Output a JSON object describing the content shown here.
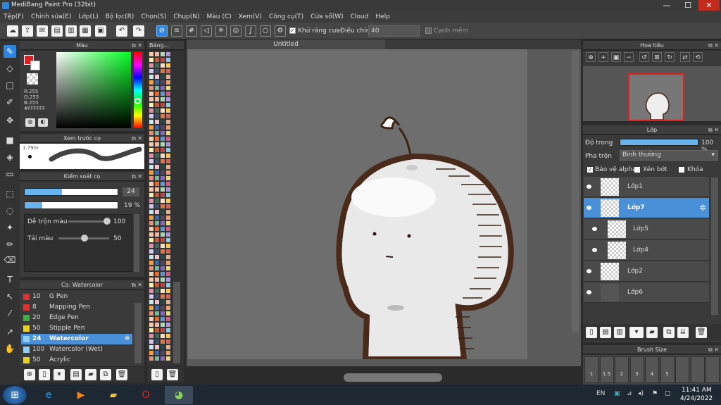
{
  "window": {
    "title": "MediBang Paint Pro (32bit)",
    "min": "—",
    "max": "☐",
    "close": "✕"
  },
  "menu": [
    "Tệp(F)",
    "Chỉnh sửa(E)",
    "Lớp(L)",
    "Bộ lọc(R)",
    "Chọn(S)",
    "Chụp(N)",
    "Màu (C)",
    "Xem(V)",
    "Công cụ(T)",
    "Cửa sổ(W)",
    "Cloud",
    "Help"
  ],
  "toolbar": {
    "antialias_label": "Khử răng cưa",
    "adjust_label": "Điều chỉnh",
    "adjust_value": "40",
    "snap_label": "Cạnh mềm"
  },
  "color_panel": {
    "title": "Màu",
    "r": "R:255",
    "g": "G:255",
    "b": "B:255",
    "hex": "#FFFFFF"
  },
  "preview_panel": {
    "title": "Xem trước cọ",
    "size": "1.79m"
  },
  "brush_control": {
    "title": "Kiểm soát cọ",
    "size": "24",
    "opacity": "19 %",
    "opacity_fraction": 0.19,
    "size_fraction": 0.4,
    "mix_label": "Dễ trộn màu",
    "mix_value": "100",
    "load_label": "Tải màu",
    "load_value": "50"
  },
  "brush_list": {
    "title": "Cọ: Watercolor",
    "items": [
      {
        "size": "10",
        "name": "G Pen",
        "color": "#e03030"
      },
      {
        "size": "8",
        "name": "Mapping Pen",
        "color": "#e03030"
      },
      {
        "size": "20",
        "name": "Edge Pen",
        "color": "#3cb043"
      },
      {
        "size": "50",
        "name": "Stipple Pen",
        "color": "#e8d020"
      },
      {
        "size": "24",
        "name": "Watercolor",
        "color": "#8fd0f0"
      },
      {
        "size": "100",
        "name": "Watercolor (Wet)",
        "color": "#8fd0f0"
      },
      {
        "size": "50",
        "name": "Acrylic",
        "color": "#e8d020"
      }
    ]
  },
  "palette_panel": {
    "title": "Bảng..."
  },
  "canvas": {
    "title": "Untitled"
  },
  "navigator": {
    "title": "Hoa tiêu"
  },
  "layer_panel": {
    "title": "Lớp",
    "opacity_label": "Độ trong",
    "opacity_value": "100 %",
    "blend_label": "Pha trộn",
    "blend_value": "Bình thường",
    "protect_alpha": "Bảo vệ alpha",
    "clipping": "Xén bớt",
    "lock": "Khóa",
    "layers": [
      "Lớp1",
      "Lớp7",
      "Lớp5",
      "Lớp4",
      "Lớp2",
      "Lớp6"
    ]
  },
  "brush_size_panel": {
    "title": "Brush Size",
    "sizes": [
      "1",
      "1.5",
      "2",
      "3",
      "4",
      "5"
    ]
  },
  "taskbar": {
    "lang": "EN",
    "time": "11:41 AM",
    "date": "4/24/2022"
  }
}
